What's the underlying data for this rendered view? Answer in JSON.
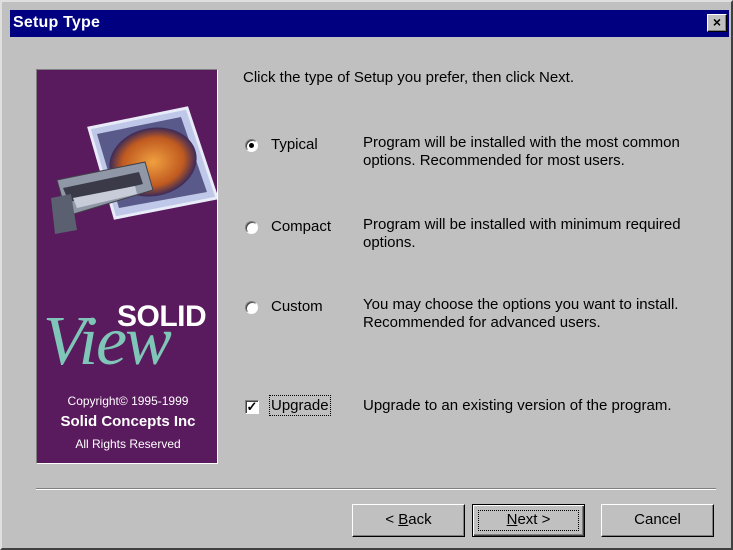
{
  "window": {
    "title": "Setup Type",
    "close_label": "×"
  },
  "logo": {
    "brand_solid": "SOLID",
    "brand_view": "View",
    "copyright": "Copyright© 1995-1999",
    "company": "Solid Concepts Inc",
    "rights": "All Rights Reserved"
  },
  "prompt": "Click the type of Setup you prefer, then click Next.",
  "options": [
    {
      "label": "Typical",
      "selected": true,
      "description": "Program will be installed with the most common options. Recommended for most users."
    },
    {
      "label": "Compact",
      "selected": false,
      "description": "Program will be installed with minimum required options."
    },
    {
      "label": "Custom",
      "selected": false,
      "description": "You may choose the options you want to install. Recommended for advanced users."
    }
  ],
  "upgrade": {
    "label": "Upgrade",
    "checked": true,
    "description": "Upgrade to an existing version of the program."
  },
  "buttons": {
    "back_prefix": "< ",
    "back_key": "B",
    "back_rest": "ack",
    "next_key": "N",
    "next_rest": "ext >",
    "cancel": "Cancel"
  },
  "colors": {
    "titlebar": "#000080",
    "logo_bg": "#5a1a5e",
    "logo_view": "#7fc6b8"
  }
}
